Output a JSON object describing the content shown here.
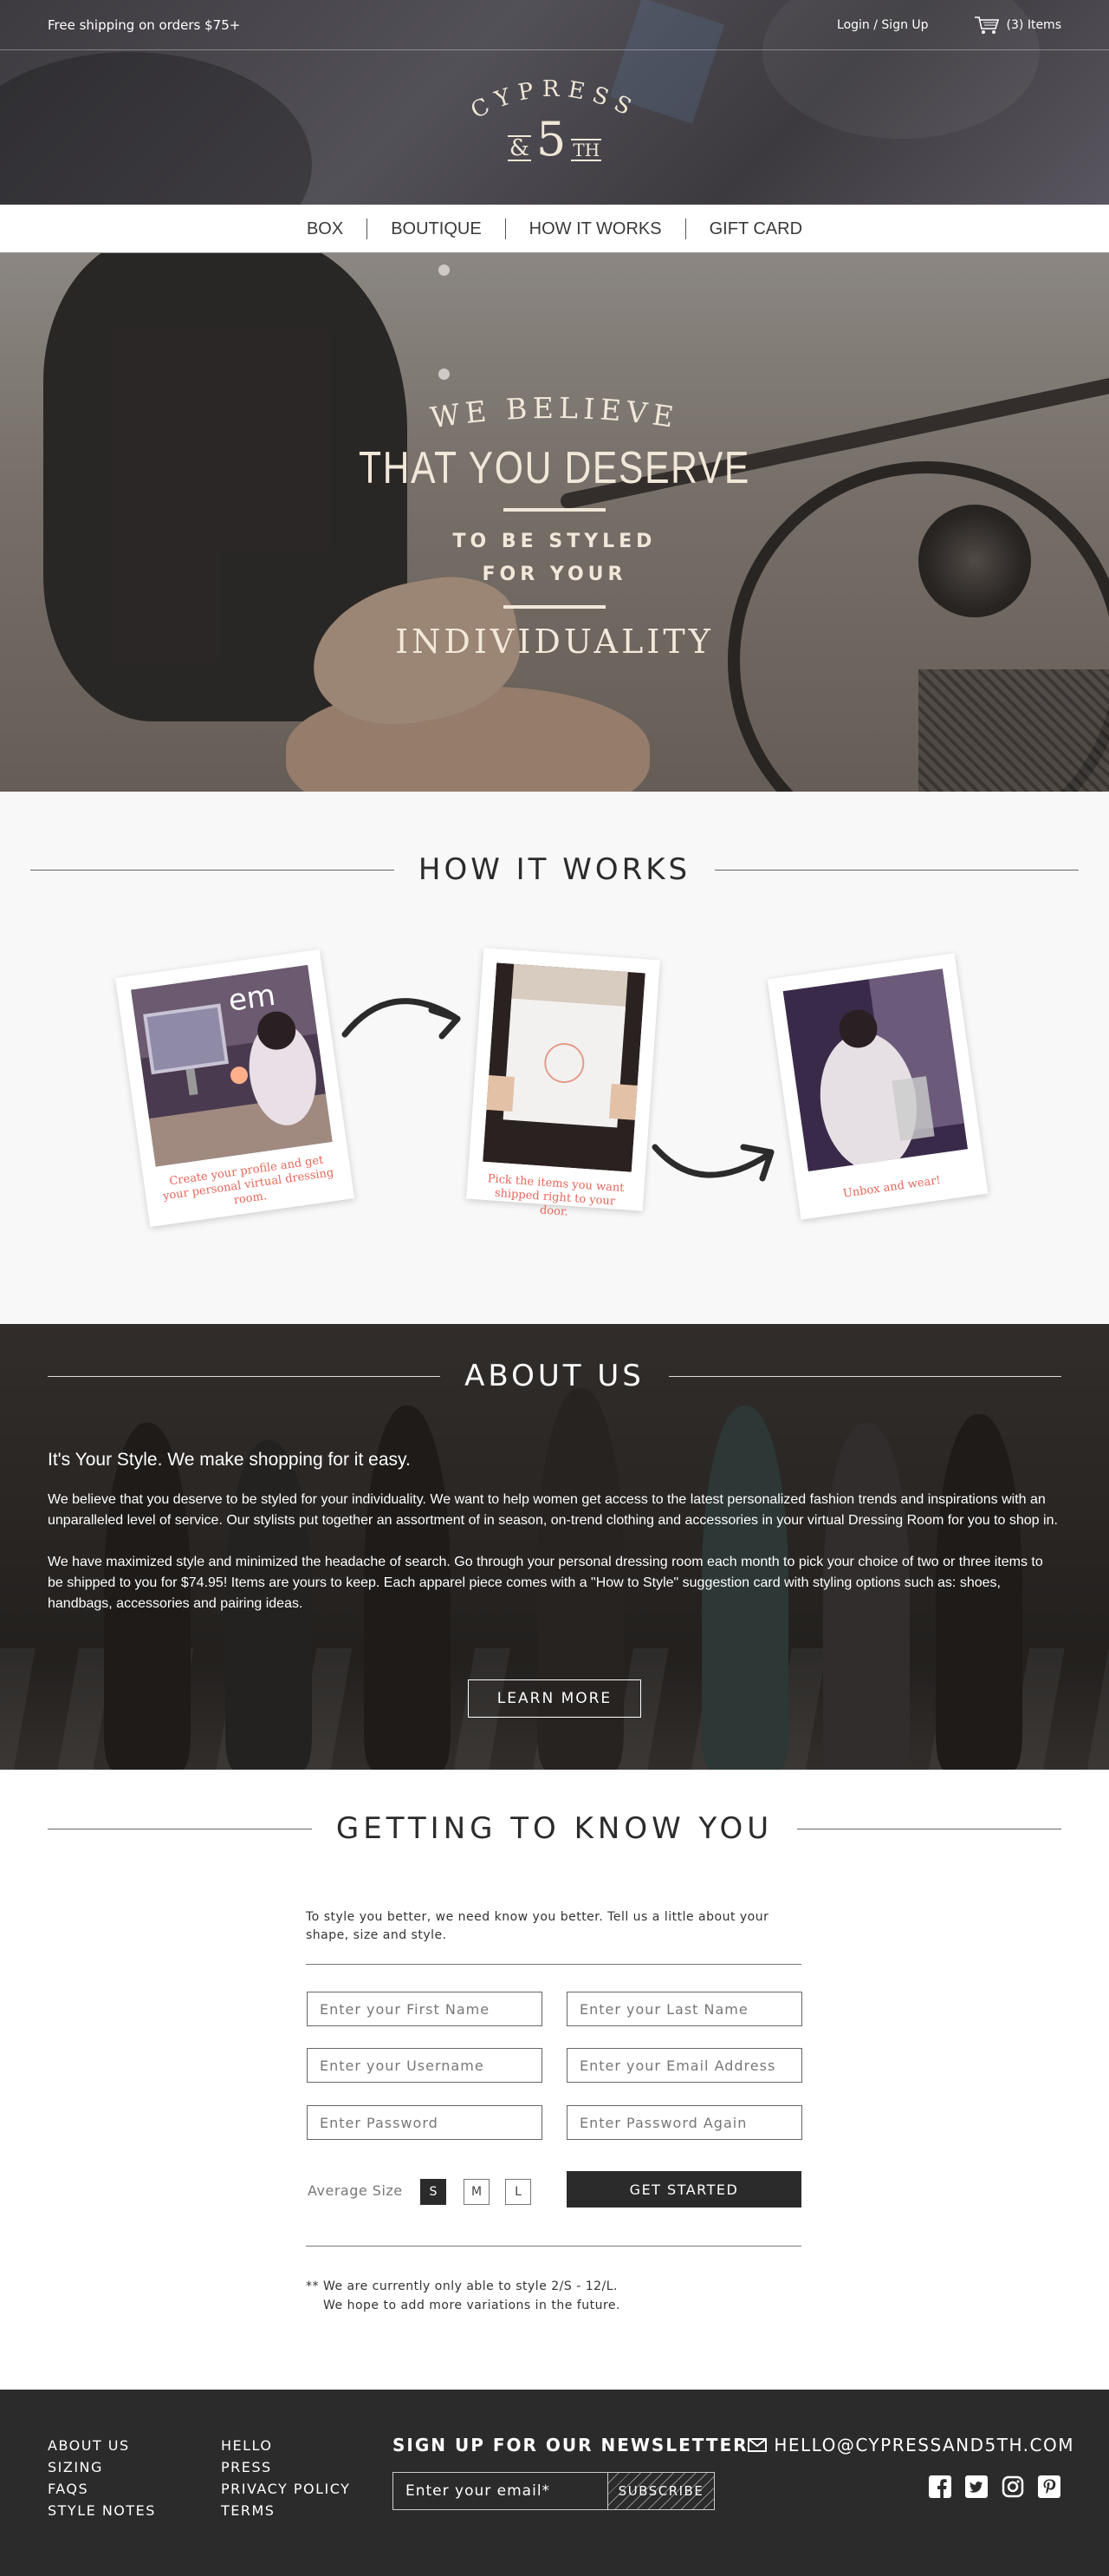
{
  "topbar": {
    "shipping": "Free shipping on orders $75+",
    "login": "Login / Sign Up",
    "cart": "(3) Items"
  },
  "logo": {
    "word": "CYPRESS",
    "amp": "&",
    "number": "5",
    "suffix": "TH"
  },
  "nav": {
    "items": [
      "BOX",
      "BOUTIQUE",
      "HOW IT WORKS",
      "GIFT CARD"
    ]
  },
  "hero": {
    "line1": "WE BELIEVE",
    "line2": "THAT YOU DESERVE",
    "line3a": "TO BE STYLED",
    "line3b": "FOR YOUR",
    "line4": "INDIVIDUALITY"
  },
  "how": {
    "title": "HOW IT WORKS",
    "steps": [
      {
        "caption": "Create your profile and get your personal virtual dressing room."
      },
      {
        "caption": "Pick the items you want shipped right to your door."
      },
      {
        "caption": "Unbox and wear!"
      }
    ]
  },
  "about": {
    "title": "ABOUT US",
    "headline": "It's Your Style.  We make shopping for it easy.",
    "p1": "We believe that you deserve to be styled for your individuality. We want to help women get access to the latest personalized fashion trends and inspirations with an unparalleled level of service.  Our stylists put together an assortment of in season, on-trend clothing and accessories in your virtual Dressing Room for you to shop in.",
    "p2": "We have maximized style and minimized the headache of search.  Go through your personal dressing room each month to pick your choice of two or three items to be shipped to you for $74.95!  Items are yours to keep.  Each apparel piece comes with a \"How to Style\" suggestion card with styling options such as: shoes, handbags, accessories and pairing ideas.",
    "button": "LEARN MORE"
  },
  "know": {
    "title": "GETTING TO KNOW YOU",
    "intro": "To style you better, we need know you better. Tell us a little about your shape, size and style.",
    "fields": {
      "first_name": "Enter your First Name",
      "last_name": "Enter your Last Name",
      "username": "Enter your Username",
      "email": "Enter your Email Address",
      "password": "Enter Password",
      "password_again": "Enter Password Again"
    },
    "size_label": "Average Size",
    "sizes": [
      "S",
      "M",
      "L"
    ],
    "selected_size": "S",
    "button": "GET STARTED",
    "note1": "** We are currently only able to style 2/S - 12/L.",
    "note2": "We hope to add more variations in the future."
  },
  "footer": {
    "col1": [
      "ABOUT US",
      "SIZING",
      "FAQS",
      "STYLE NOTES"
    ],
    "col2": [
      "HELLO",
      "PRESS",
      "PRIVACY POLICY",
      "TERMS"
    ],
    "newsletter_title": "SIGN UP FOR OUR NEWSLETTER",
    "newsletter_placeholder": "Enter your email*",
    "subscribe": "SUBSCRIBE",
    "email": "HELLO@CYPRESSAND5TH.COM",
    "socials": [
      "facebook-icon",
      "twitter-icon",
      "instagram-icon",
      "pinterest-icon"
    ]
  },
  "colors": {
    "dark": "#2b2b2b",
    "cream": "#efe6d6",
    "caption_red": "#e5665a"
  }
}
